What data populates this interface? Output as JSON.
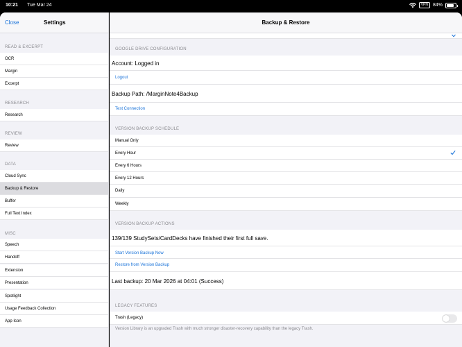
{
  "status": {
    "time": "10:21",
    "date": "Tue Mar 24",
    "vpn": "VPN",
    "battery": "84%",
    "battery_level": 0.84
  },
  "sidebar": {
    "close_label": "Close",
    "title": "Settings",
    "sections": [
      {
        "header": "READ & EXCERPT",
        "items": [
          "OCR",
          "Margin",
          "Excerpt"
        ]
      },
      {
        "header": "RESEARCH",
        "items": [
          "Research"
        ]
      },
      {
        "header": "REVIEW",
        "items": [
          "Review"
        ]
      },
      {
        "header": "DATA",
        "items": [
          "Cloud Sync",
          "Backup & Restore",
          "Buffer",
          "Full Text Index"
        ]
      },
      {
        "header": "MISC",
        "items": [
          "Speech",
          "Handoff",
          "Extension",
          "Presentation",
          "Spotlight",
          "Usage Feedback Collection",
          "App Icon"
        ]
      }
    ],
    "selected": "Backup & Restore"
  },
  "main": {
    "title": "Backup & Restore",
    "google_drive": {
      "header": "GOOGLE DRIVE CONFIGURATION",
      "account": "Account: Logged in",
      "logout": "Logout",
      "backup_path": "Backup Path: /MarginNote4Backup",
      "test_connection": "Test Connection"
    },
    "schedule": {
      "header": "VERSION BACKUP SCHEDULE",
      "options": [
        "Manual Only",
        "Every Hour",
        "Every 6 Hours",
        "Every 12 Hours",
        "Daily",
        "Weekly"
      ],
      "selected": "Every Hour"
    },
    "actions": {
      "header": "VERSION BACKUP ACTIONS",
      "status": "139/139 StudySets/CardDecks have finished their first full save.",
      "start": "Start Version Backup Now",
      "restore": "Restore from Version Backup",
      "last_backup": "Last backup: 20 Mar 2026 at 04:01 (Success)"
    },
    "legacy": {
      "header": "LEGACY FEATURES",
      "trash_label": "Trash (Legacy)",
      "trash_on": false,
      "footnote": "Version Library is an upgraded Trash with much stronger disaster-recovery capability than the legacy Trash."
    }
  },
  "colors": {
    "accent": "#1a73d9",
    "background": "#f2f2f7",
    "selected_row": "#dcdce0"
  }
}
